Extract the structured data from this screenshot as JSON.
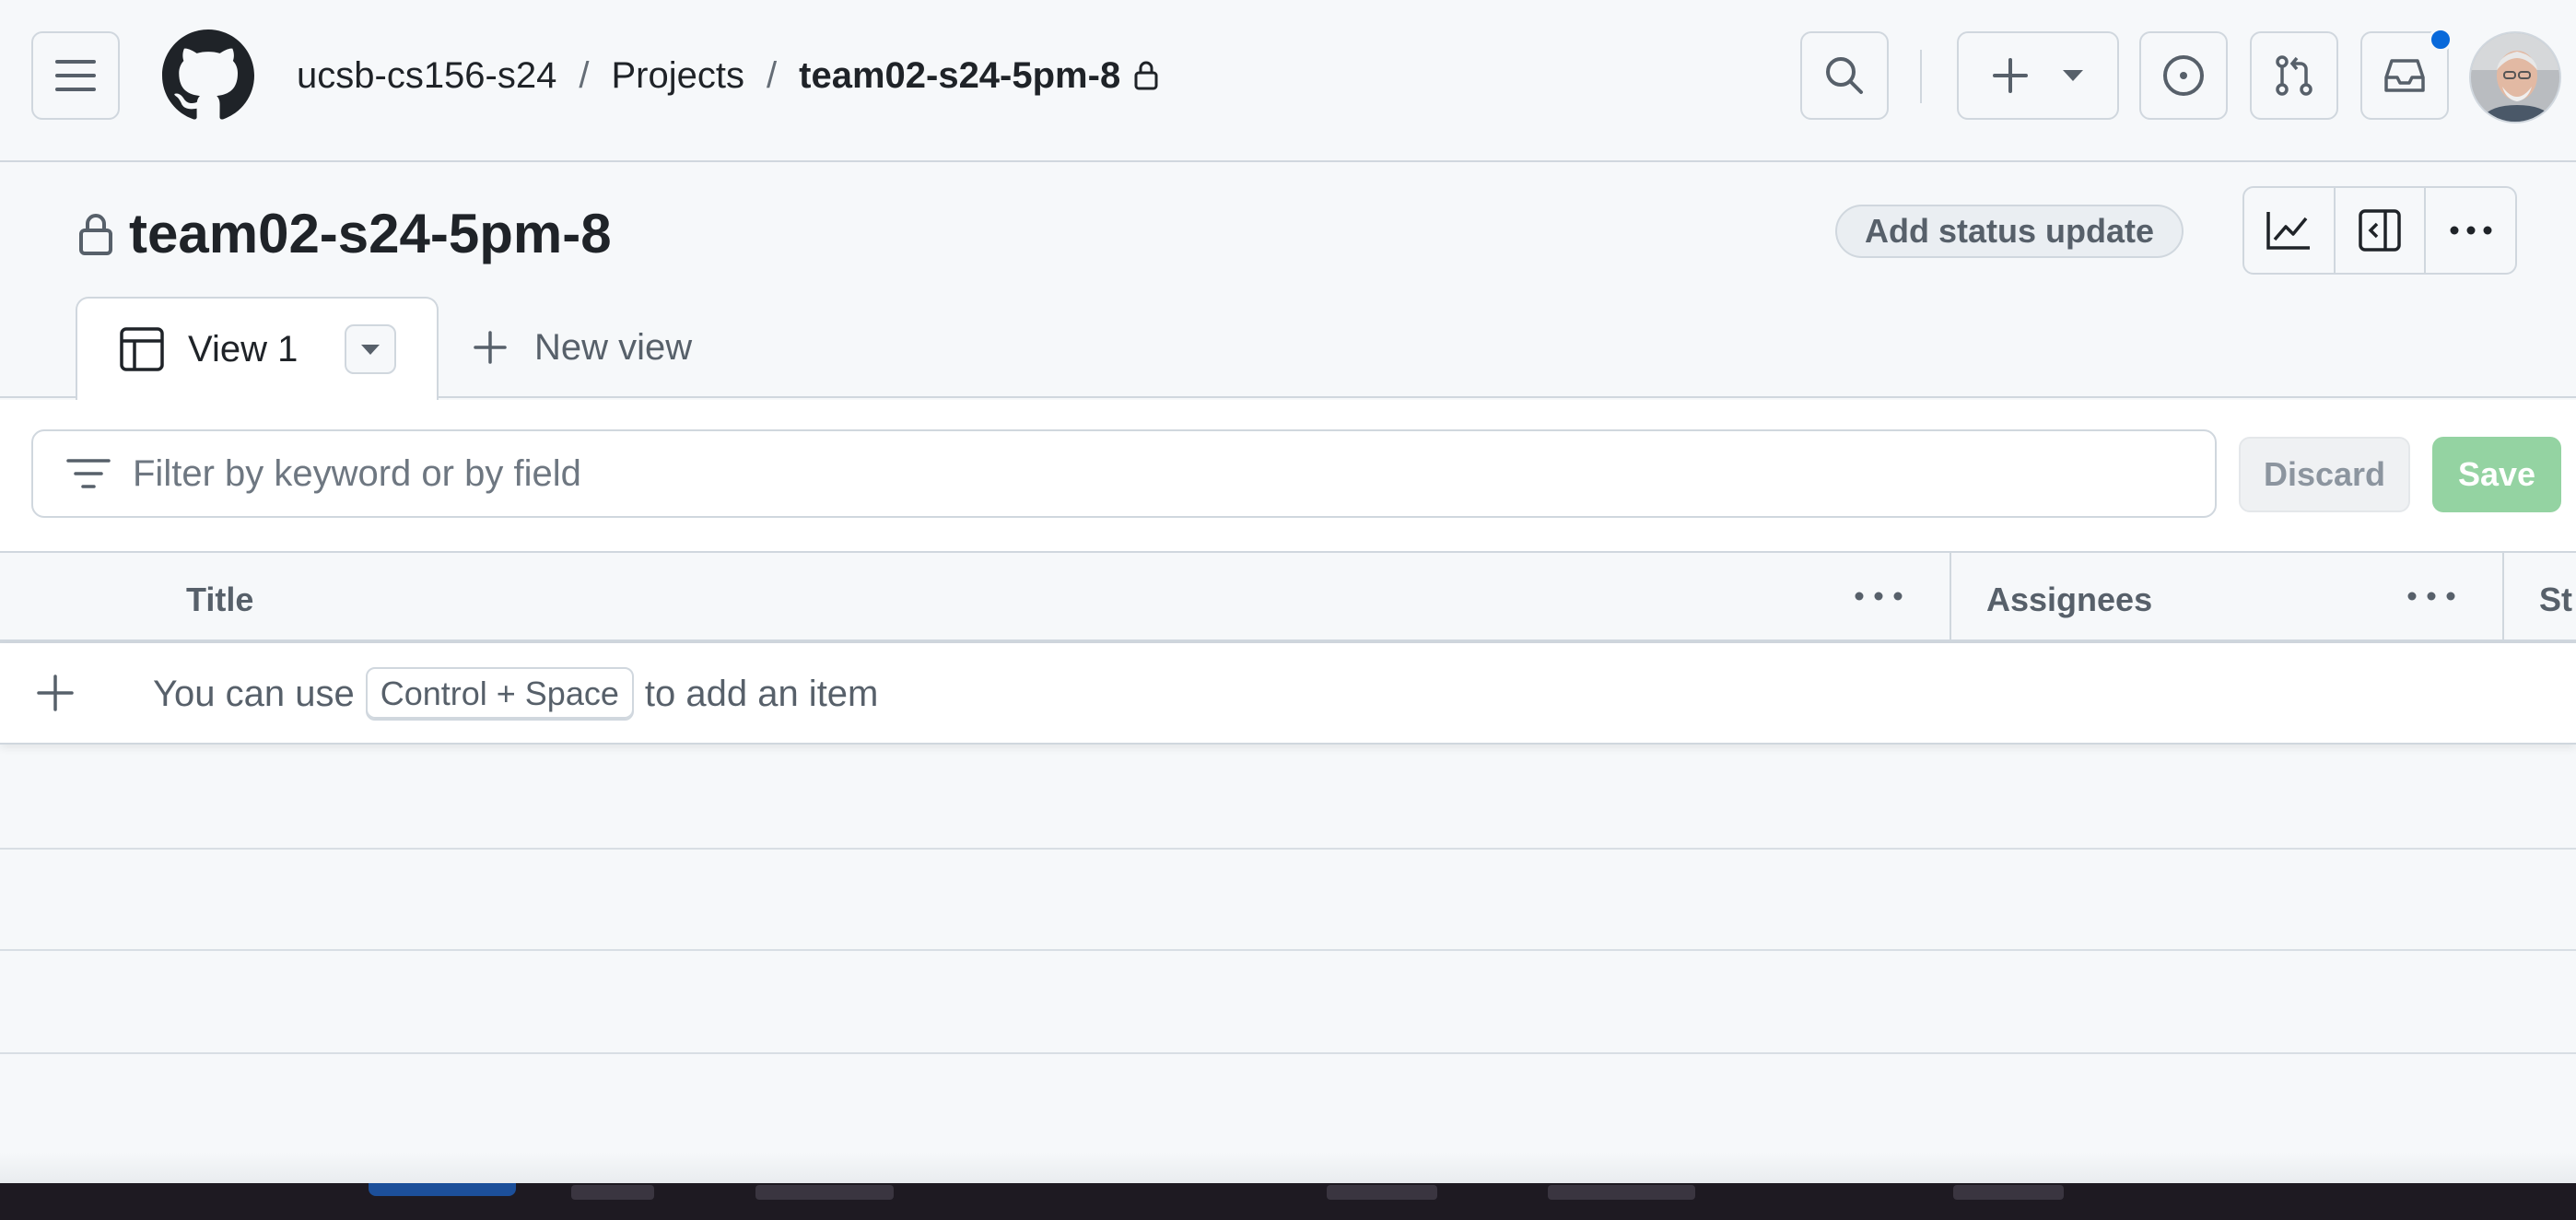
{
  "header": {
    "breadcrumb": {
      "org": "ucsb-cs156-s24",
      "separator": "/",
      "section": "Projects",
      "project": "team02-s24-5pm-8"
    }
  },
  "project": {
    "title": "team02-s24-5pm-8",
    "status_update_label": "Add status update"
  },
  "tabs": {
    "active": {
      "label": "View 1"
    },
    "new_view_label": "New view"
  },
  "filter": {
    "placeholder": "Filter by keyword or by field",
    "discard_label": "Discard",
    "save_label": "Save"
  },
  "table": {
    "columns": [
      {
        "label": "Title"
      },
      {
        "label": "Assignees"
      },
      {
        "label": "St"
      }
    ],
    "add_item": {
      "prefix": "You can use",
      "shortcut": "Control + Space",
      "suffix": "to add an item"
    }
  },
  "colors": {
    "accent": "#0969da",
    "save_disabled": "#94d3a2",
    "border": "#d0d7de",
    "background": "#f6f8fa"
  },
  "icons": [
    "menu-icon",
    "github-logo-icon",
    "lock-icon",
    "search-icon",
    "plus-icon",
    "triangle-down-icon",
    "issue-icon",
    "pull-request-icon",
    "inbox-icon",
    "graph-icon",
    "sidebar-expand-icon",
    "kebab-horizontal-icon",
    "table-icon",
    "filter-icon"
  ]
}
